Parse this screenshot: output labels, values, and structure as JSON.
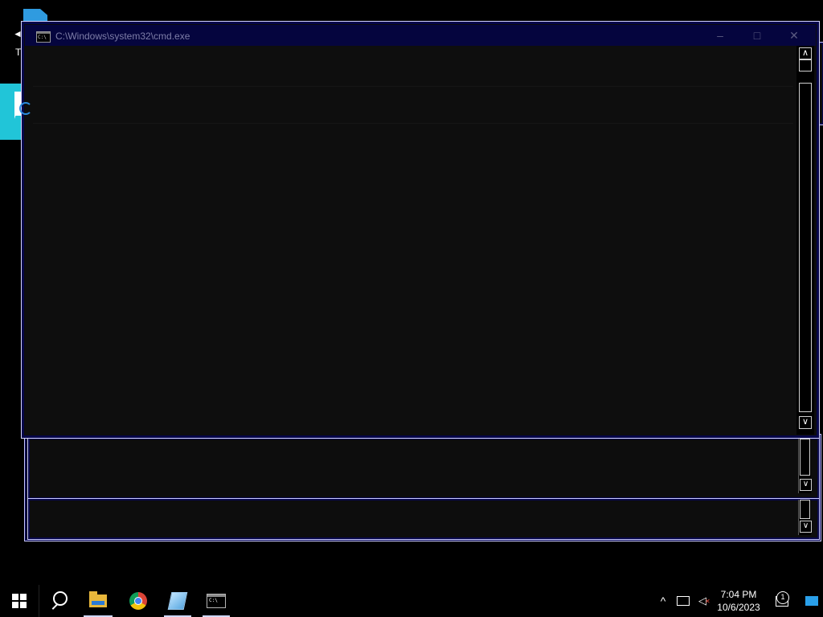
{
  "window": {
    "title": "C:\\Windows\\system32\\cmd.exe",
    "minimize_glyph": "–",
    "maximize_glyph": "□",
    "close_glyph": "✕"
  },
  "scrollbar": {
    "up_glyph": "∧",
    "down_glyph": "∨"
  },
  "desktop": {
    "left_arrow_glyph": "◄",
    "left_t_glyph": "T"
  },
  "cmd_icon_text": "C:\\",
  "taskbar": {
    "apps": [
      {
        "name": "File Explorer",
        "icon": "folder-icon",
        "active": true
      },
      {
        "name": "Google Chrome",
        "icon": "chrome-icon",
        "active": false
      },
      {
        "name": "Notepad",
        "icon": "notepad-icon",
        "active": true
      },
      {
        "name": "Command Prompt",
        "icon": "cmd-icon",
        "active": true
      }
    ],
    "tray_chevron_glyph": "^",
    "clock_time": "7:04 PM",
    "clock_date": "10/6/2023",
    "notification_count": "1"
  },
  "colors": {
    "titlebar": "#05053e",
    "desktop_tile": "#21c5d8",
    "taskbar_bg": "#000000"
  }
}
